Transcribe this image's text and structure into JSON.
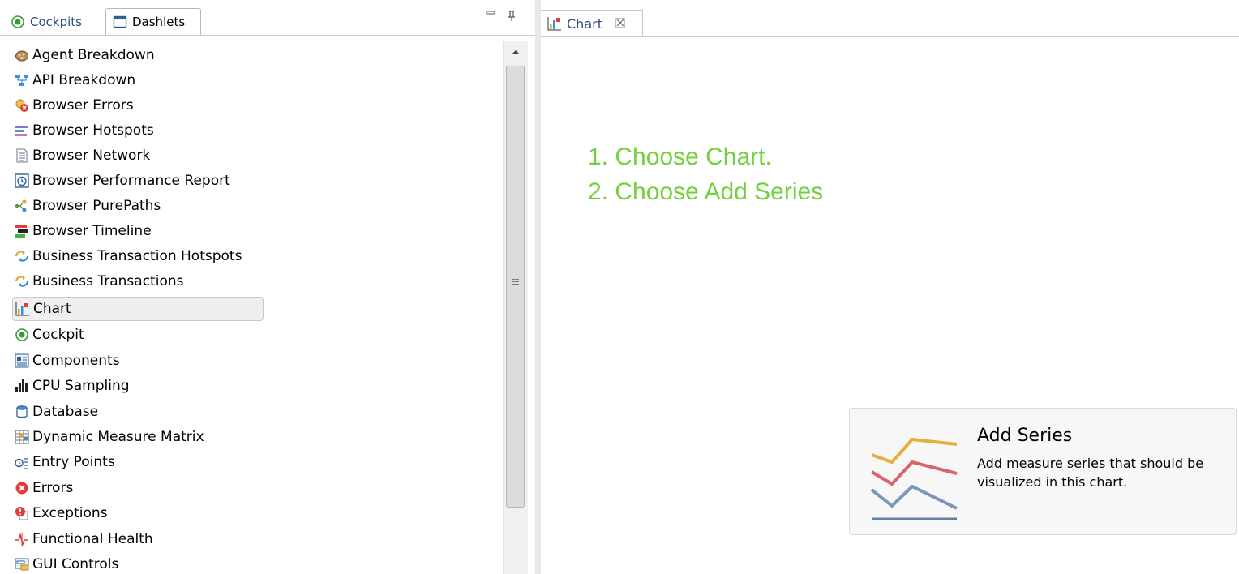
{
  "left_view": {
    "tabs": [
      {
        "label": "Cockpits",
        "icon": "cockpit-icon"
      },
      {
        "label": "Dashlets",
        "icon": "dashlets-icon",
        "active": true
      }
    ],
    "controls": {
      "minimize": "minimize-icon",
      "pin": "pin-icon"
    },
    "items": [
      {
        "label": "Agent Breakdown",
        "icon": "agent-breakdown-icon"
      },
      {
        "label": "API Breakdown",
        "icon": "api-breakdown-icon"
      },
      {
        "label": "Browser Errors",
        "icon": "browser-errors-icon"
      },
      {
        "label": "Browser Hotspots",
        "icon": "browser-hotspots-icon"
      },
      {
        "label": "Browser Network",
        "icon": "browser-network-icon"
      },
      {
        "label": "Browser Performance Report",
        "icon": "browser-performance-report-icon"
      },
      {
        "label": "Browser PurePaths",
        "icon": "browser-purepaths-icon"
      },
      {
        "label": "Browser Timeline",
        "icon": "browser-timeline-icon"
      },
      {
        "label": "Business Transaction Hotspots",
        "icon": "business-transaction-hotspots-icon"
      },
      {
        "label": "Business Transactions",
        "icon": "business-transactions-icon"
      },
      {
        "label": "Chart",
        "icon": "chart-icon",
        "selected": true
      },
      {
        "label": "Cockpit",
        "icon": "cockpit-icon"
      },
      {
        "label": "Components",
        "icon": "components-icon"
      },
      {
        "label": "CPU Sampling",
        "icon": "cpu-sampling-icon"
      },
      {
        "label": "Database",
        "icon": "database-icon"
      },
      {
        "label": "Dynamic Measure Matrix",
        "icon": "dynamic-measure-matrix-icon"
      },
      {
        "label": "Entry Points",
        "icon": "entry-points-icon"
      },
      {
        "label": "Errors",
        "icon": "errors-icon"
      },
      {
        "label": "Exceptions",
        "icon": "exceptions-icon"
      },
      {
        "label": "Functional Health",
        "icon": "functional-health-icon"
      },
      {
        "label": "GUI Controls",
        "icon": "gui-controls-icon"
      }
    ]
  },
  "editor": {
    "tab": {
      "label": "Chart",
      "icon": "chart-icon",
      "close_icon": "close-icon"
    },
    "instructions": [
      "1. Choose Chart.",
      "2. Choose Add Series"
    ],
    "add_series": {
      "title": "Add Series",
      "description": "Add measure series that should be visualized in this chart.",
      "icon": "add-series-lines-icon"
    }
  },
  "colors": {
    "instruction_green": "#74cf3f",
    "series_orange": "#e8ad3c",
    "series_red": "#d9646b",
    "series_blue": "#7b96b8",
    "baseline_blue": "#5f7fa6"
  }
}
